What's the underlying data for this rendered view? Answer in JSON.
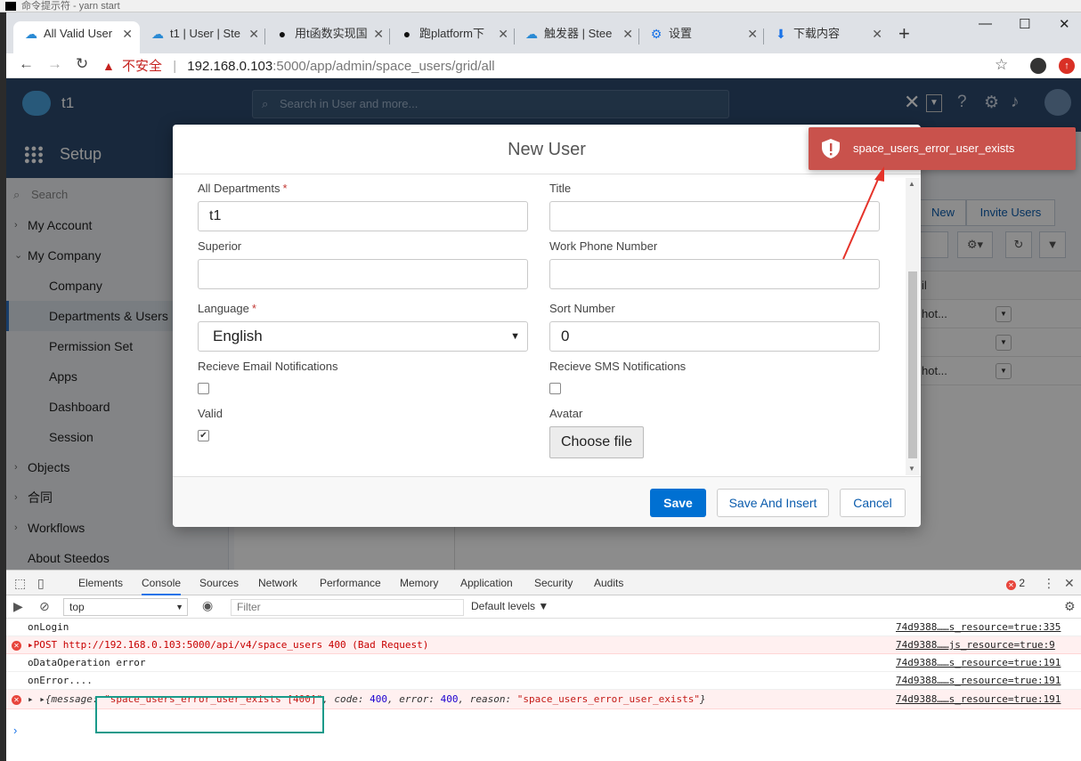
{
  "cmd_title": "命令提示符 - yarn  start",
  "tabs": [
    {
      "label": "All Valid User",
      "icon": "steedos-icon",
      "active": true
    },
    {
      "label": "t1 | User | Ste",
      "icon": "steedos-icon"
    },
    {
      "label": "用t函数实现国",
      "icon": "github-icon"
    },
    {
      "label": "跑platform下",
      "icon": "github-icon"
    },
    {
      "label": "触发器 | Stee",
      "icon": "steedos-icon"
    },
    {
      "label": "设置",
      "icon": "gear-icon"
    },
    {
      "label": "下载内容",
      "icon": "download-icon"
    }
  ],
  "address": {
    "insecure_label": "不安全",
    "host": "192.168.0.103",
    "rest": ":5000/app/admin/space_users/grid/all"
  },
  "app": {
    "name": "t1",
    "search_placeholder": "Search in User and more...",
    "setup_title": "Setup"
  },
  "sidebar": {
    "search_placeholder": "Search",
    "items": [
      {
        "label": "My Account",
        "level": "top",
        "caret": "›"
      },
      {
        "label": "My Company",
        "level": "top",
        "caret": "⌄"
      },
      {
        "label": "Company",
        "level": "sub"
      },
      {
        "label": "Departments & Users",
        "level": "sub",
        "selected": true
      },
      {
        "label": "Permission Set",
        "level": "sub"
      },
      {
        "label": "Apps",
        "level": "sub"
      },
      {
        "label": "Dashboard",
        "level": "sub"
      },
      {
        "label": "Session",
        "level": "sub"
      },
      {
        "label": "Objects",
        "level": "top",
        "caret": "›"
      },
      {
        "label": "合同",
        "level": "top",
        "caret": "›"
      },
      {
        "label": "Workflows",
        "level": "top",
        "caret": "›"
      },
      {
        "label": "About Steedos",
        "level": "top"
      }
    ]
  },
  "content": {
    "new_label": "New",
    "invite_label": "Invite Users",
    "col_header": "il",
    "rows": [
      "hot...",
      "",
      "hot..."
    ]
  },
  "modal": {
    "title": "New User",
    "fields": {
      "all_departments": {
        "label": "All Departments",
        "value": "t1"
      },
      "title": {
        "label": "Title",
        "value": ""
      },
      "superior": {
        "label": "Superior",
        "value": ""
      },
      "work_phone": {
        "label": "Work Phone Number",
        "value": ""
      },
      "language": {
        "label": "Language",
        "value": "English"
      },
      "sort_number": {
        "label": "Sort Number",
        "value": "0"
      },
      "email_notif": {
        "label": "Recieve Email Notifications",
        "checked": false
      },
      "sms_notif": {
        "label": "Recieve SMS Notifications",
        "checked": false
      },
      "valid": {
        "label": "Valid",
        "checked": true
      },
      "avatar": {
        "label": "Avatar",
        "button": "Choose file"
      }
    },
    "required_mark": "*",
    "save_label": "Save",
    "save_insert_label": "Save And Insert",
    "cancel_label": "Cancel"
  },
  "toast": {
    "message": "space_users_error_user_exists"
  },
  "devtools": {
    "tabs": [
      "Elements",
      "Console",
      "Sources",
      "Network",
      "Performance",
      "Memory",
      "Application",
      "Security",
      "Audits"
    ],
    "active_tab": "Console",
    "error_count": "2",
    "context": "top",
    "filter_placeholder": "Filter",
    "levels_label": "Default levels ▼",
    "lines": [
      {
        "type": "log",
        "text": "onLogin",
        "src": "74d9388……s_resource=true:335"
      },
      {
        "type": "error",
        "text": "▸POST http://192.168.0.103:5000/api/v4/space_users 400 (Bad Request)",
        "src": "74d9388……js_resource=true:9"
      },
      {
        "type": "log",
        "text": "oDataOperation error",
        "src": "74d9388……s_resource=true:191"
      },
      {
        "type": "log",
        "text": "onError....",
        "src": "74d9388……s_resource=true:191"
      },
      {
        "type": "error",
        "text": "",
        "src": "74d9388……s_resource=true:191"
      }
    ],
    "obj_line": {
      "prefix": "▸ ▸{message: ",
      "message": "\"space_users_error_user_exists [400]\"",
      "code_key": ", code: ",
      "code": "400",
      "error_key": ", error: ",
      "error": "400",
      "reason_key": ", reason: ",
      "reason": "\"space_users_error_user_exists\"",
      "suffix": "}"
    }
  },
  "colors": {
    "header": "#2c4a6e",
    "save": "#0070d2",
    "toast": "#c9524c",
    "highlight": "#1a9a8a",
    "arrow": "#e5332a"
  }
}
